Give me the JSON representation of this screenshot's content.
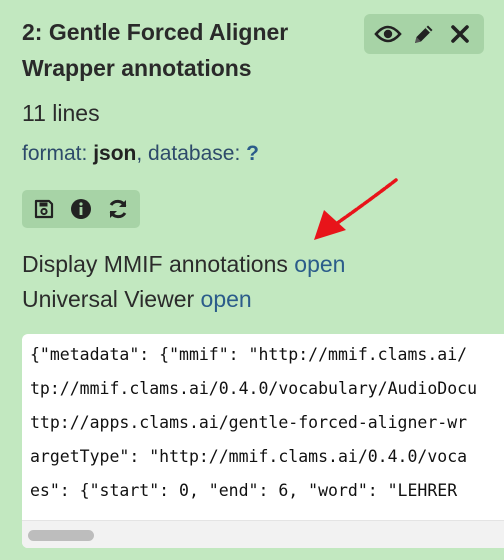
{
  "dataset": {
    "title": "2: Gentle Forced Aligner Wrapper annotations",
    "lines": "11 lines",
    "format_label": "format:",
    "format_value": "json",
    "database_label": ", database:",
    "database_value": "?"
  },
  "toolbar": {
    "icons": [
      "eye-icon",
      "pencil-icon",
      "close-icon"
    ]
  },
  "actions": {
    "icons": [
      "save-icon",
      "info-icon",
      "rerun-icon"
    ]
  },
  "display": {
    "mmif_label": "Display MMIF annotations",
    "mmif_link": "open",
    "viewer_label": "Universal Viewer",
    "viewer_link": "open"
  },
  "preview": {
    "lines": [
      "{\"metadata\": {\"mmif\": \"http://mmif.clams.ai/",
      "tp://mmif.clams.ai/0.4.0/vocabulary/AudioDocu",
      "ttp://apps.clams.ai/gentle-forced-aligner-wr",
      "argetType\": \"http://mmif.clams.ai/0.4.0/voca",
      "es\": {\"start\": 0, \"end\": 6, \"word\": \"LEHRER"
    ]
  },
  "colors": {
    "background": "#c2e8c0",
    "toolbar": "#a7d3a6",
    "link": "#2b5c8a",
    "annotation_arrow": "#e8141a"
  }
}
